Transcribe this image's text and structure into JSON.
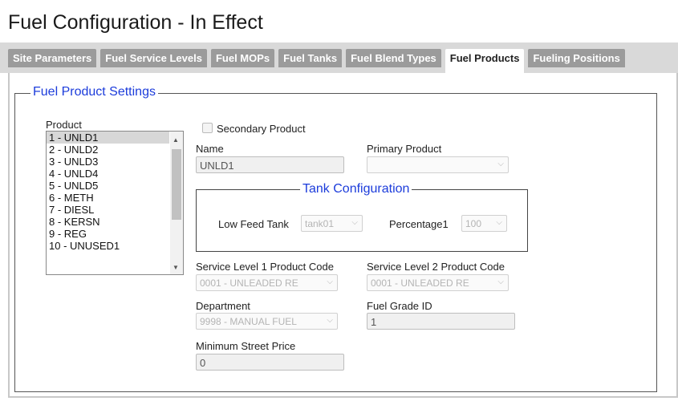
{
  "page": {
    "title": "Fuel Configuration - In Effect"
  },
  "tabs": [
    {
      "label": "Site Parameters"
    },
    {
      "label": "Fuel Service Levels"
    },
    {
      "label": "Fuel MOPs"
    },
    {
      "label": "Fuel Tanks"
    },
    {
      "label": "Fuel Blend Types"
    },
    {
      "label": "Fuel Products"
    },
    {
      "label": "Fueling Positions"
    }
  ],
  "active_tab": "Fuel Products",
  "settings": {
    "legend": "Fuel Product Settings",
    "product_label": "Product",
    "products": [
      "1 - UNLD1",
      "2 - UNLD2",
      "3 - UNLD3",
      "4 - UNLD4",
      "5 - UNLD5",
      "6 - METH",
      "7 - DIESL",
      "8 - KERSN",
      "9 - REG",
      "10 - UNUSED1"
    ],
    "selected_product": "1 - UNLD1",
    "secondary_product_label": "Secondary Product",
    "secondary_product_checked": false,
    "name_label": "Name",
    "name_value": "UNLD1",
    "primary_product_label": "Primary Product",
    "primary_product_value": "",
    "tank_config": {
      "legend": "Tank Configuration",
      "low_feed_label": "Low Feed Tank",
      "low_feed_value": "tank01",
      "percentage_label": "Percentage1",
      "percentage_value": "100"
    },
    "sl1_label": "Service Level 1 Product Code",
    "sl1_value": "0001 - UNLEADED RE",
    "sl2_label": "Service Level 2 Product Code",
    "sl2_value": "0001 - UNLEADED RE",
    "department_label": "Department",
    "department_value": "9998 - MANUAL FUEL",
    "grade_label": "Fuel Grade ID",
    "grade_value": "1",
    "min_price_label": "Minimum Street Price",
    "min_price_value": "0"
  }
}
